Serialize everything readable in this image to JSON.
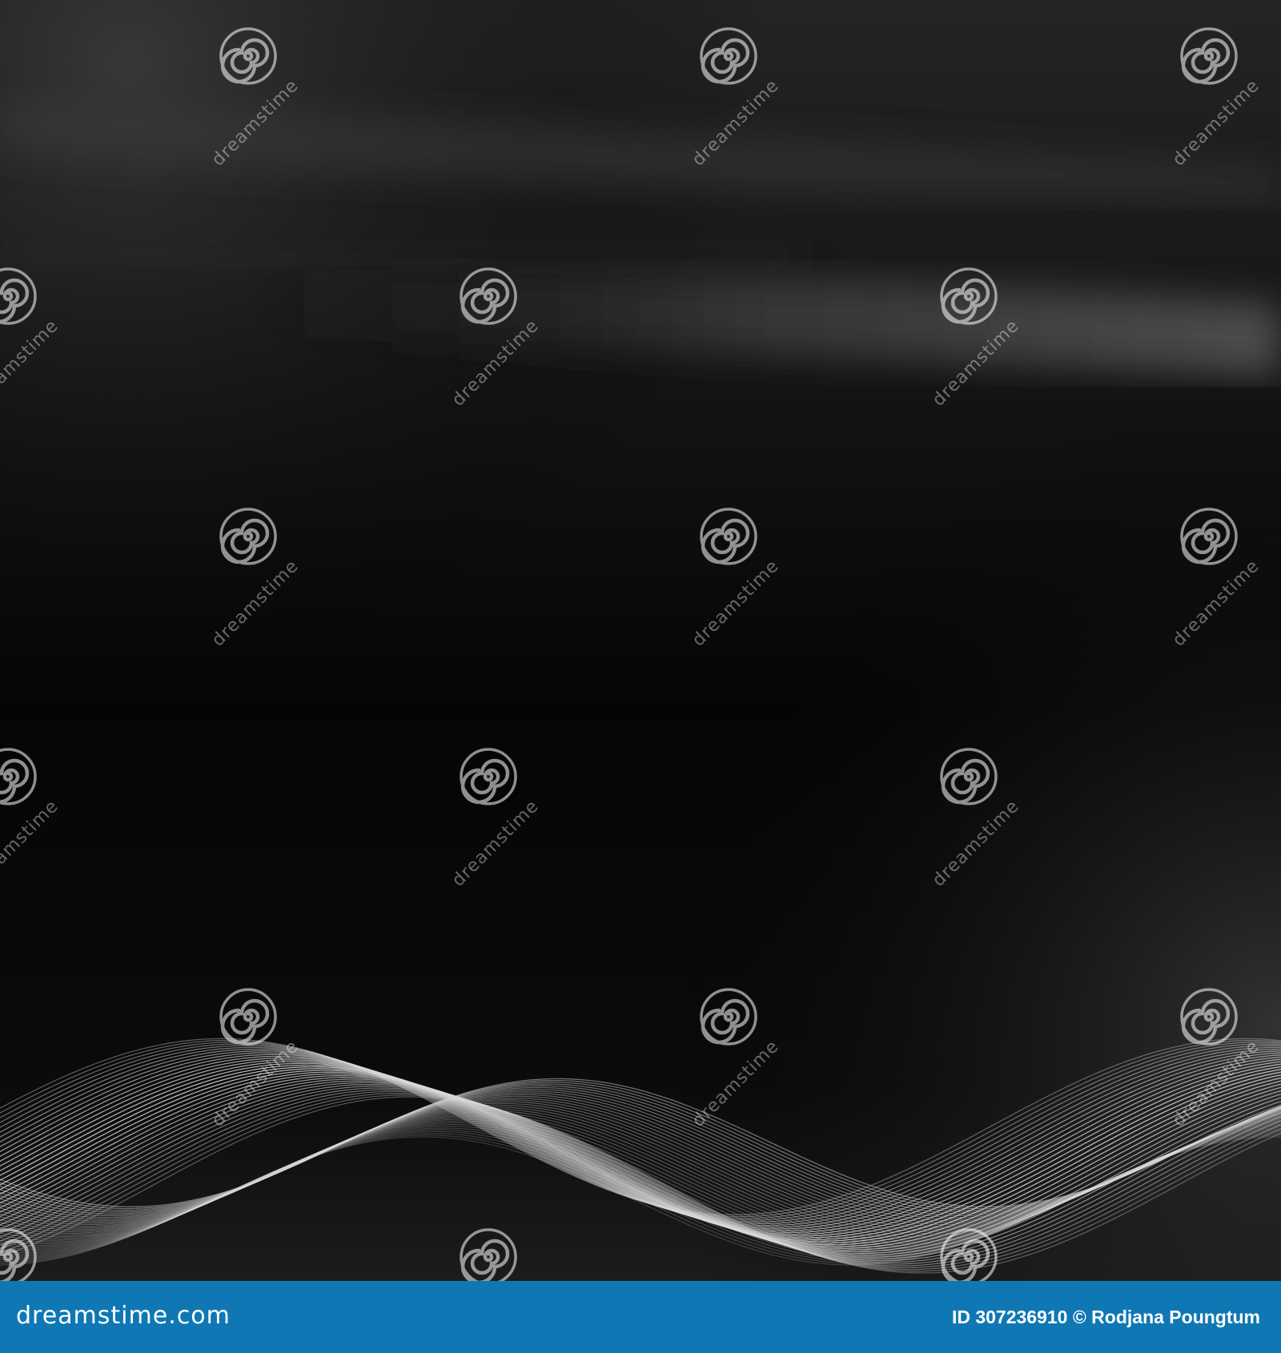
{
  "image": {
    "description_colors": {
      "background": "#000000",
      "wave_lines": "#d8d8d8",
      "credit_bar": "#0f78b4"
    }
  },
  "watermark": {
    "text": "dreamstime",
    "icon": "spiral-logo-icon"
  },
  "credit_bar": {
    "brand": "dreamstime.com",
    "credit": "ID 307236910 © Rodjana Poungtum"
  }
}
